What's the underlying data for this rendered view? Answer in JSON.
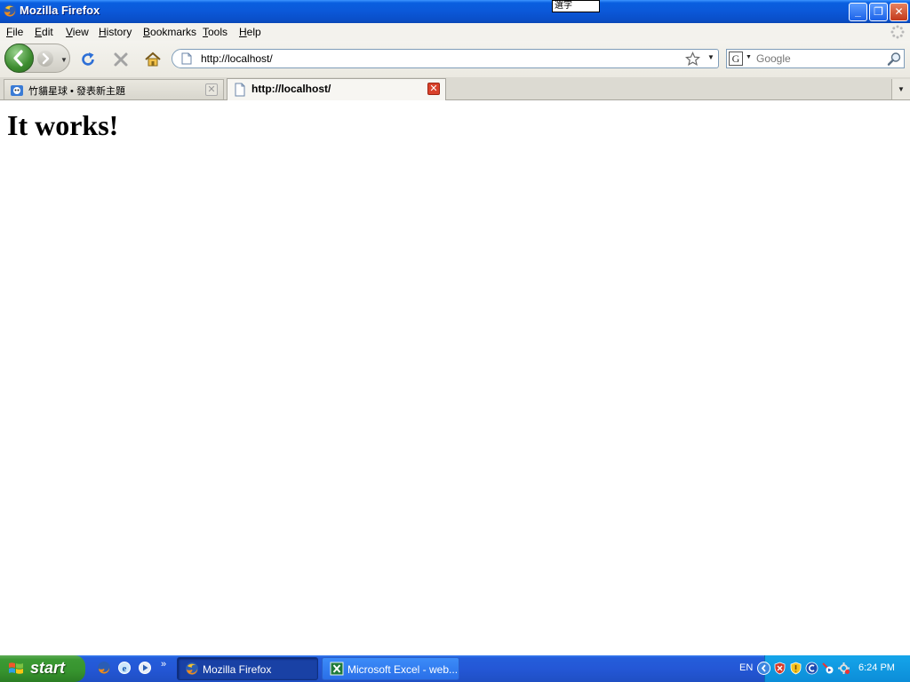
{
  "window": {
    "title": "Mozilla Firefox",
    "ime_text": "選字",
    "buttons": {
      "minimize": "_",
      "maximize": "❐",
      "close": "✕"
    }
  },
  "menu": {
    "items": [
      "File",
      "Edit",
      "View",
      "History",
      "Bookmarks",
      "Tools",
      "Help"
    ]
  },
  "nav": {
    "url": "http://localhost/",
    "search_placeholder": "Google",
    "search_engine_letter": "G"
  },
  "tabs": [
    {
      "label": "竹貓星球 • 發表新主題",
      "active": false
    },
    {
      "label": "http://localhost/",
      "active": true
    }
  ],
  "page": {
    "heading": "It works!"
  },
  "taskbar": {
    "start_label": "start",
    "tasks": [
      {
        "label": "Mozilla Firefox",
        "active": true
      },
      {
        "label": "Microsoft Excel - web...",
        "active": false
      }
    ],
    "language": "EN",
    "clock": "6:24 PM"
  },
  "colors": {
    "titlebar": "#0b58d8",
    "taskbar": "#245edb",
    "start": "#3c9a34",
    "tray": "#0c8dd8"
  }
}
